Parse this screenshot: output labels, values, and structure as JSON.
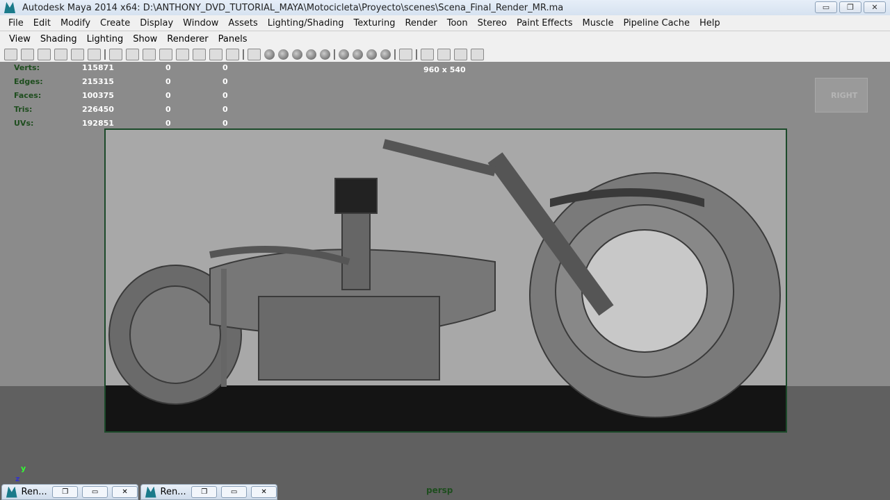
{
  "window": {
    "title": "Autodesk Maya 2014 x64: D:\\ANTHONY_DVD_TUTORIAL_MAYA\\Motocicleta\\Proyecto\\scenes\\Scena_Final_Render_MR.ma",
    "minimize": "▭",
    "restore": "❐",
    "close": "✕"
  },
  "menu": [
    "File",
    "Edit",
    "Modify",
    "Create",
    "Display",
    "Window",
    "Assets",
    "Lighting/Shading",
    "Texturing",
    "Render",
    "Toon",
    "Stereo",
    "Paint Effects",
    "Muscle",
    "Pipeline Cache",
    "Help"
  ],
  "panel_menu": [
    "View",
    "Shading",
    "Lighting",
    "Show",
    "Renderer",
    "Panels"
  ],
  "hud": [
    {
      "label": "Verts:",
      "v": "115871",
      "a": "0",
      "b": "0"
    },
    {
      "label": "Edges:",
      "v": "215315",
      "a": "0",
      "b": "0"
    },
    {
      "label": "Faces:",
      "v": "100375",
      "a": "0",
      "b": "0"
    },
    {
      "label": "Tris:",
      "v": "226450",
      "a": "0",
      "b": "0"
    },
    {
      "label": "UVs:",
      "v": "192851",
      "a": "0",
      "b": "0"
    }
  ],
  "resolution": "960 x 540",
  "view_cube": "RIGHT",
  "camera": "persp",
  "axis": {
    "y": "y",
    "z": "z"
  },
  "taskbar": [
    {
      "label": "Ren...",
      "restore": "❐",
      "max": "▭",
      "close": "✕"
    },
    {
      "label": "Ren...",
      "restore": "❐",
      "max": "▭",
      "close": "✕"
    }
  ]
}
